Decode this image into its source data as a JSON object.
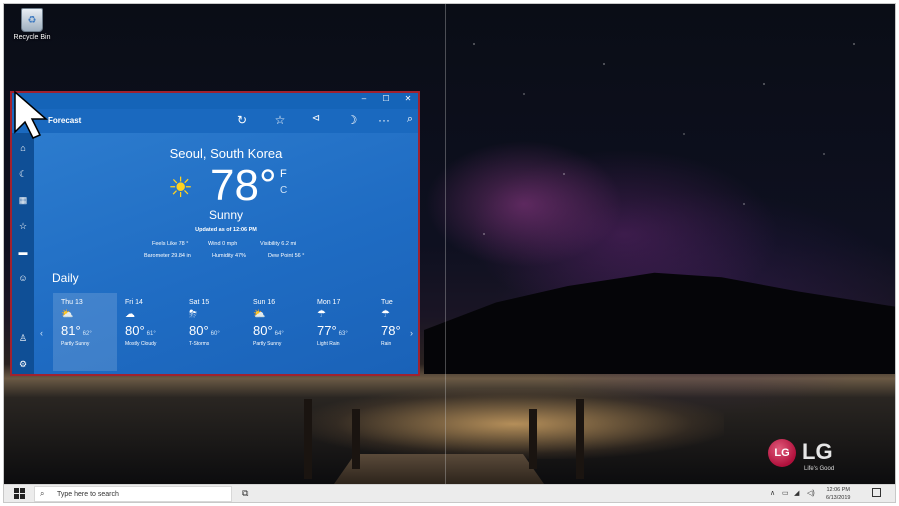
{
  "desktop": {
    "recycle_bin_label": "Recycle Bin"
  },
  "weather_app": {
    "nav_heading": "Forecast",
    "location": "Seoul, South Korea",
    "temperature": "78°",
    "unit_f": "F",
    "unit_c": "C",
    "condition": "Sunny",
    "updated": "Updated as of 12:06 PM",
    "details_row1": [
      {
        "label": "Feels Like",
        "value": "78 °"
      },
      {
        "label": "Wind",
        "value": "0 mph"
      },
      {
        "label": "Visibility",
        "value": "6.2 mi"
      }
    ],
    "details_row2": [
      {
        "label": "Barometer",
        "value": "29.84 in"
      },
      {
        "label": "Humidity",
        "value": "47%"
      },
      {
        "label": "Dew Point",
        "value": "56 °"
      }
    ],
    "daily_title": "Daily",
    "days": [
      {
        "day": "Thu 13",
        "hi": "81°",
        "lo": "62°",
        "cond": "Partly Sunny",
        "icon": "partly-sunny-icon",
        "selected": true
      },
      {
        "day": "Fri 14",
        "hi": "80°",
        "lo": "61°",
        "cond": "Mostly Cloudy",
        "icon": "cloudy-icon"
      },
      {
        "day": "Sat 15",
        "hi": "80°",
        "lo": "60°",
        "cond": "T-Storms",
        "icon": "storm-icon"
      },
      {
        "day": "Sun 16",
        "hi": "80°",
        "lo": "64°",
        "cond": "Partly Sunny",
        "icon": "partly-sunny-icon"
      },
      {
        "day": "Mon 17",
        "hi": "77°",
        "lo": "63°",
        "cond": "Light Rain",
        "icon": "rain-icon"
      },
      {
        "day": "Tue",
        "hi": "78°",
        "lo": "",
        "cond": "Rain",
        "icon": "rain-icon"
      }
    ],
    "accent_color": "#1f6cc3",
    "highlight_border": "#a0222f"
  },
  "brand": {
    "logo_letters": "LG",
    "name": "LG",
    "tagline": "Life's Good"
  },
  "taskbar": {
    "search_placeholder": "Type here to search",
    "time": "12:06 PM",
    "date": "6/13/2019"
  }
}
